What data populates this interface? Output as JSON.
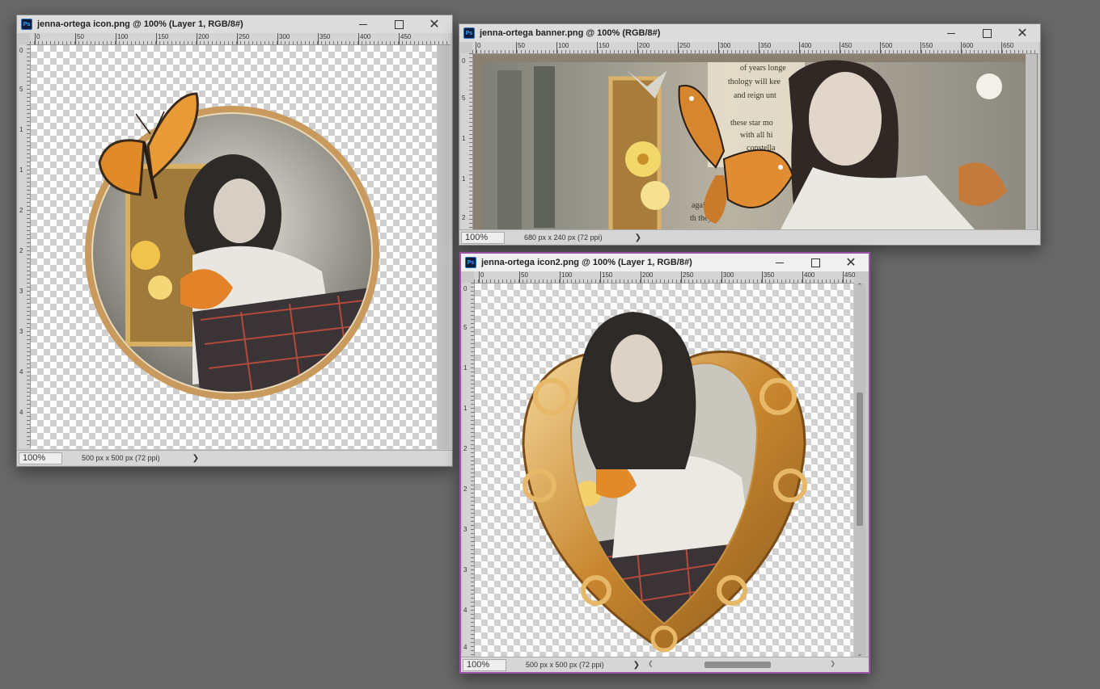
{
  "windows": {
    "icon": {
      "title": "jenna-ortega icon.png @ 100% (Layer 1, RGB/8#)",
      "zoom": "100%",
      "doc_info": "500 px x 500 px (72 ppi)",
      "ruler_h": [
        "0",
        "50",
        "100",
        "150",
        "200",
        "250",
        "300",
        "350",
        "400",
        "450"
      ],
      "ruler_v": [
        "0",
        "5",
        "1",
        "1",
        "2",
        "2",
        "3",
        "3",
        "4",
        "4"
      ]
    },
    "banner": {
      "title": "jenna-ortega banner.png @ 100% (RGB/8#)",
      "zoom": "100%",
      "doc_info": "680 px x 240 px (72 ppi)",
      "ruler_h": [
        "0",
        "50",
        "100",
        "150",
        "200",
        "250",
        "300",
        "350",
        "400",
        "450",
        "500",
        "550",
        "600",
        "650"
      ],
      "ruler_v": [
        "0",
        "5",
        "1",
        "1",
        "2"
      ],
      "banner_text": [
        "of years longe",
        "thology will kee",
        "and reign unt",
        "these star mo",
        "with all hi",
        "constella",
        "again",
        "th they"
      ]
    },
    "icon2": {
      "title": "jenna-ortega icon2.png @ 100% (Layer 1, RGB/8#)",
      "zoom": "100%",
      "doc_info": "500 px x 500 px (72 ppi)",
      "ruler_h": [
        "0",
        "50",
        "100",
        "150",
        "200",
        "250",
        "300",
        "350",
        "400",
        "450"
      ],
      "ruler_v": [
        "0",
        "5",
        "1",
        "1",
        "2",
        "2",
        "3",
        "3",
        "4",
        "4"
      ]
    }
  },
  "glyphs": {
    "close": "✕",
    "arrow_right": "❯",
    "arrow_left": "❮",
    "arrow_up": "⌃",
    "arrow_down": "⌄",
    "ps": "Ps"
  },
  "colors": {
    "frame_gold": "#c8924a",
    "butterfly_orange": "#e08a2a",
    "active_border": "#9a55a9"
  }
}
